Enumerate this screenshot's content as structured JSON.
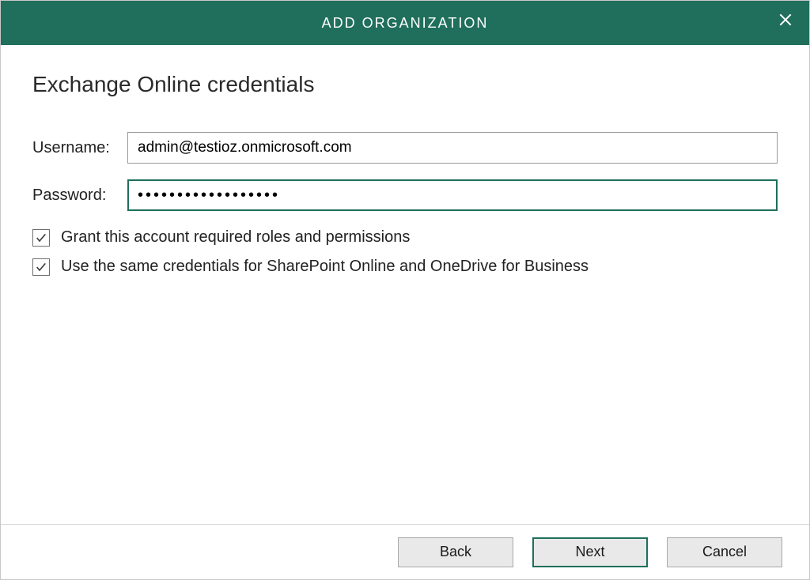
{
  "titlebar": {
    "title": "ADD ORGANIZATION"
  },
  "heading": "Exchange Online credentials",
  "form": {
    "username_label": "Username:",
    "username_value": "admin@testioz.onmicrosoft.com",
    "password_label": "Password:",
    "password_value": "••••••••••••••••••"
  },
  "checks": {
    "grant_roles": "Grant this account required roles and permissions",
    "same_creds": "Use the same credentials for SharePoint Online and OneDrive for Business"
  },
  "footer": {
    "back": "Back",
    "next": "Next",
    "cancel": "Cancel"
  }
}
